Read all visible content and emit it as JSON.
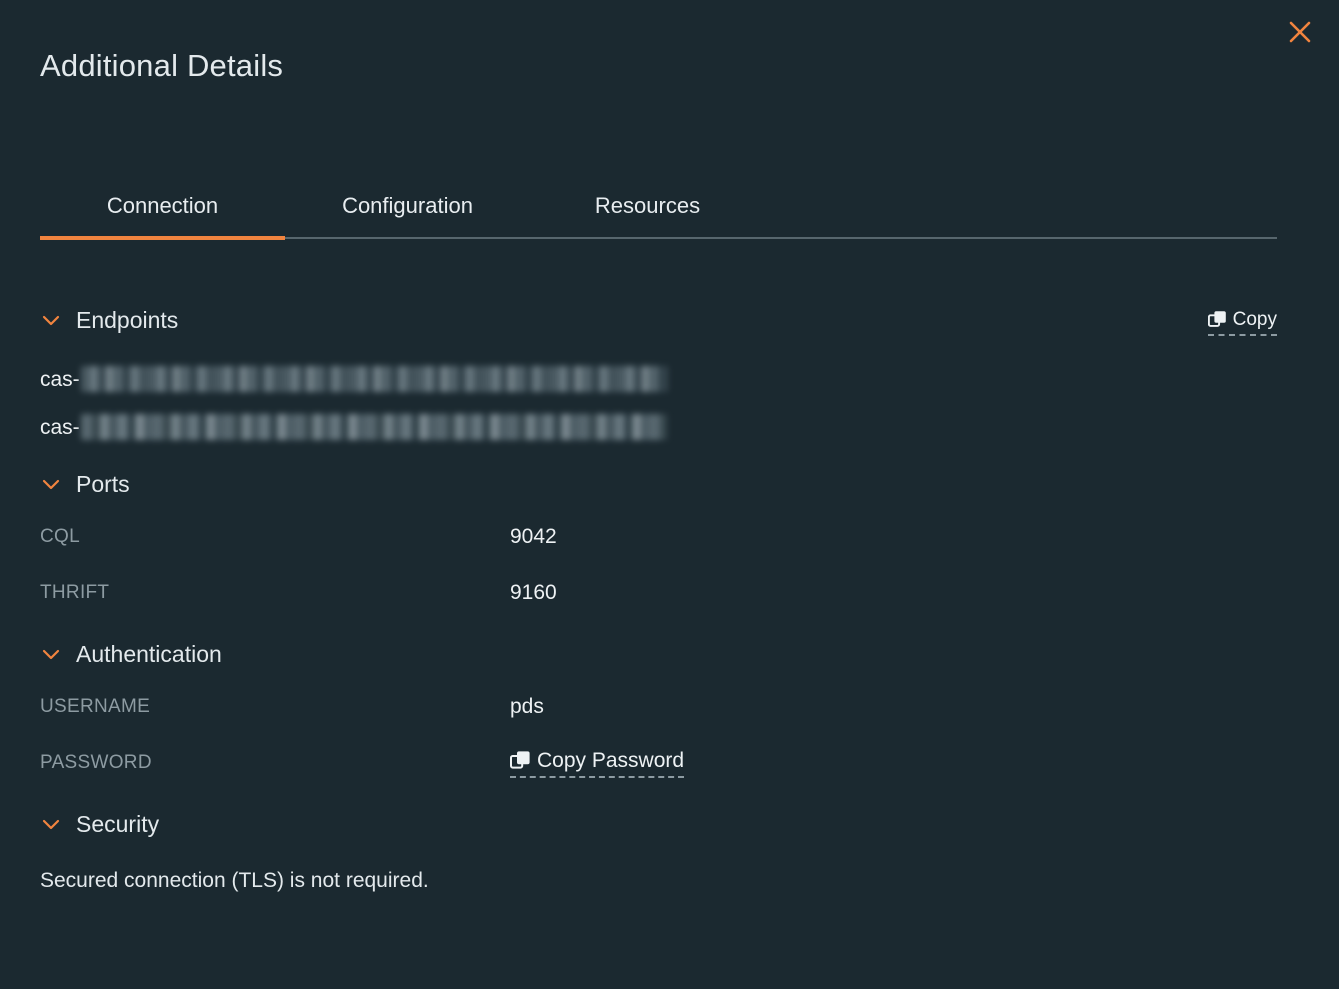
{
  "window": {
    "title": "Additional Details",
    "close_icon": "close-icon",
    "accent_color": "#f1843f",
    "background_color": "#1b2930",
    "text_color": "#e3e9ec",
    "muted_text_color": "#8d9ba2"
  },
  "tabs": {
    "items": [
      {
        "label": "Connection",
        "active": true
      },
      {
        "label": "Configuration",
        "active": false
      },
      {
        "label": "Resources",
        "active": false
      }
    ]
  },
  "sections": {
    "endpoints": {
      "title": "Endpoints",
      "chevron_icon": "chevron-down-icon",
      "copy": {
        "label": "Copy",
        "icon": "copy-icon"
      },
      "rows": [
        {
          "prefix": "cas-",
          "value": "",
          "redacted": true
        },
        {
          "prefix": "cas-",
          "value": "",
          "redacted": true
        }
      ]
    },
    "ports": {
      "title": "Ports",
      "chevron_icon": "chevron-down-icon",
      "rows": [
        {
          "key": "CQL",
          "value": "9042"
        },
        {
          "key": "THRIFT",
          "value": "9160"
        }
      ]
    },
    "authentication": {
      "title": "Authentication",
      "chevron_icon": "chevron-down-icon",
      "rows": [
        {
          "key": "USERNAME",
          "value": "pds"
        }
      ],
      "password": {
        "key": "PASSWORD",
        "action_label": "Copy Password",
        "icon": "copy-icon"
      }
    },
    "security": {
      "title": "Security",
      "chevron_icon": "chevron-down-icon",
      "message": "Secured connection (TLS) is not required."
    }
  }
}
